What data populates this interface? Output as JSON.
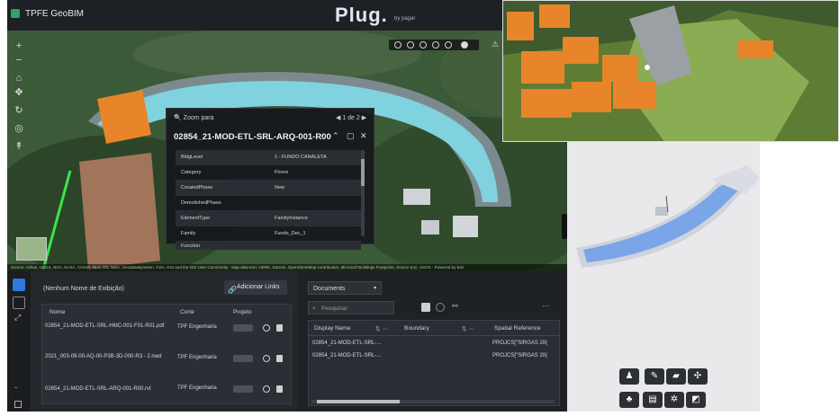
{
  "app": {
    "name": "TPFE GeoBIM",
    "brand": "Plug.",
    "brand_sub": "by pagar"
  },
  "map": {
    "attribution": "Source: Airbus, USGS, NGA, NASA, CGIAR, NLS, OS, NMA, Geodatastyrelsen, GSA, GSI and the GIS User Community · Map data Esri, HERE, Garmin, OpenStreetMap contributors, Microsoft Buildings Footprints, Source Esri, USGS · Powered by Esri"
  },
  "popup": {
    "zoom_label": "Zoom para",
    "page": "1 de 2",
    "title": "02854_21-MOD-ETL-SRL-ARQ-001-R00",
    "rows": [
      {
        "key": "BldgLevel",
        "value": "1 - FUNDO CANALETA"
      },
      {
        "key": "Category",
        "value": "Floors"
      },
      {
        "key": "CreatedPhase",
        "value": "New"
      },
      {
        "key": "DemolishedPhase",
        "value": ""
      },
      {
        "key": "ElementType",
        "value": "FamilyInstance"
      },
      {
        "key": "Family",
        "value": "Fundo_Dec_1"
      },
      {
        "key": "Function",
        "value": ""
      }
    ]
  },
  "left_panel": {
    "title": "(Nenhum Nome de Exibição)",
    "add_button": "Adicionar Links",
    "columns": [
      "Nome",
      "Corte",
      "Projeto"
    ],
    "rows": [
      {
        "name": "02854_21-MOD-ETL-SRL-HMC-001-F01-R01.pdf",
        "corte": "TPF Engenharia"
      },
      {
        "name": "2021_003-09-00-AQ-00-P3B-3D-000-R3 - 2.nwd",
        "corte": "TPF Engenharia"
      },
      {
        "name": "02854_21-MOD-ETL-SRL-ARQ-001-R00.rvt",
        "corte": "TPF Engenharia"
      }
    ]
  },
  "right_panel": {
    "dropdown": "Documents",
    "search_placeholder": "Pesquisar",
    "columns": [
      "Display Name",
      "Boundary",
      "Spatial Reference"
    ],
    "rows": [
      {
        "name": "02854_21-MOD-ETL-SRL-...",
        "spatial": "PROJCS[\"SIRGAS 20("
      },
      {
        "name": "02854_21-MOD-ETL-SRL-...",
        "spatial": "PROJCS[\"SIRGAS 20("
      }
    ]
  },
  "colors": {
    "accent": "#2f7bd8",
    "orange": "#e8852a",
    "cyan": "#7fd3e0"
  },
  "model_toolbar": {
    "icons": [
      "person-icon",
      "pencil-icon",
      "folder-icon",
      "explode-icon",
      "tree-icon",
      "list-icon",
      "settings-icon",
      "fullscreen-icon"
    ]
  }
}
